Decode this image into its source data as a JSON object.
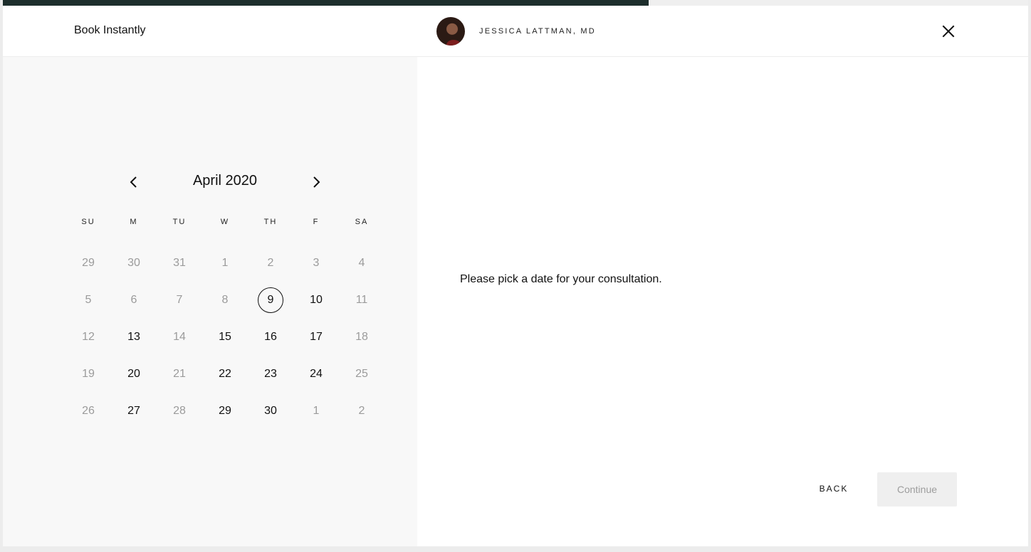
{
  "header": {
    "title": "Book Instantly",
    "provider_name": "JESSICA LATTMAN, MD",
    "progress": 0.63
  },
  "icons": {
    "close": "close-icon",
    "prev": "chevron-left-icon",
    "next": "chevron-right-icon"
  },
  "calendar": {
    "month_label": "April 2020",
    "weekdays": [
      "SU",
      "M",
      "TU",
      "W",
      "TH",
      "F",
      "SA"
    ],
    "weeks": [
      [
        {
          "d": "29",
          "s": "disabled"
        },
        {
          "d": "30",
          "s": "disabled"
        },
        {
          "d": "31",
          "s": "disabled"
        },
        {
          "d": "1",
          "s": "disabled"
        },
        {
          "d": "2",
          "s": "disabled"
        },
        {
          "d": "3",
          "s": "disabled"
        },
        {
          "d": "4",
          "s": "disabled"
        }
      ],
      [
        {
          "d": "5",
          "s": "disabled"
        },
        {
          "d": "6",
          "s": "disabled"
        },
        {
          "d": "7",
          "s": "disabled"
        },
        {
          "d": "8",
          "s": "disabled"
        },
        {
          "d": "9",
          "s": "selected"
        },
        {
          "d": "10",
          "s": "available"
        },
        {
          "d": "11",
          "s": "disabled"
        }
      ],
      [
        {
          "d": "12",
          "s": "disabled"
        },
        {
          "d": "13",
          "s": "available"
        },
        {
          "d": "14",
          "s": "disabled"
        },
        {
          "d": "15",
          "s": "available"
        },
        {
          "d": "16",
          "s": "available"
        },
        {
          "d": "17",
          "s": "available"
        },
        {
          "d": "18",
          "s": "disabled"
        }
      ],
      [
        {
          "d": "19",
          "s": "disabled"
        },
        {
          "d": "20",
          "s": "available"
        },
        {
          "d": "21",
          "s": "disabled"
        },
        {
          "d": "22",
          "s": "available"
        },
        {
          "d": "23",
          "s": "available"
        },
        {
          "d": "24",
          "s": "available"
        },
        {
          "d": "25",
          "s": "disabled"
        }
      ],
      [
        {
          "d": "26",
          "s": "disabled"
        },
        {
          "d": "27",
          "s": "available"
        },
        {
          "d": "28",
          "s": "disabled"
        },
        {
          "d": "29",
          "s": "available"
        },
        {
          "d": "30",
          "s": "available"
        },
        {
          "d": "1",
          "s": "disabled"
        },
        {
          "d": "2",
          "s": "disabled"
        }
      ]
    ]
  },
  "main": {
    "prompt": "Please pick a date for your consultation."
  },
  "footer": {
    "back_label": "BACK",
    "continue_label": "Continue"
  },
  "colors": {
    "progress": "#1d2e2c",
    "panel_bg": "#f8f8f8",
    "disabled_text": "#9b9b9b",
    "continue_bg": "#efefef"
  }
}
